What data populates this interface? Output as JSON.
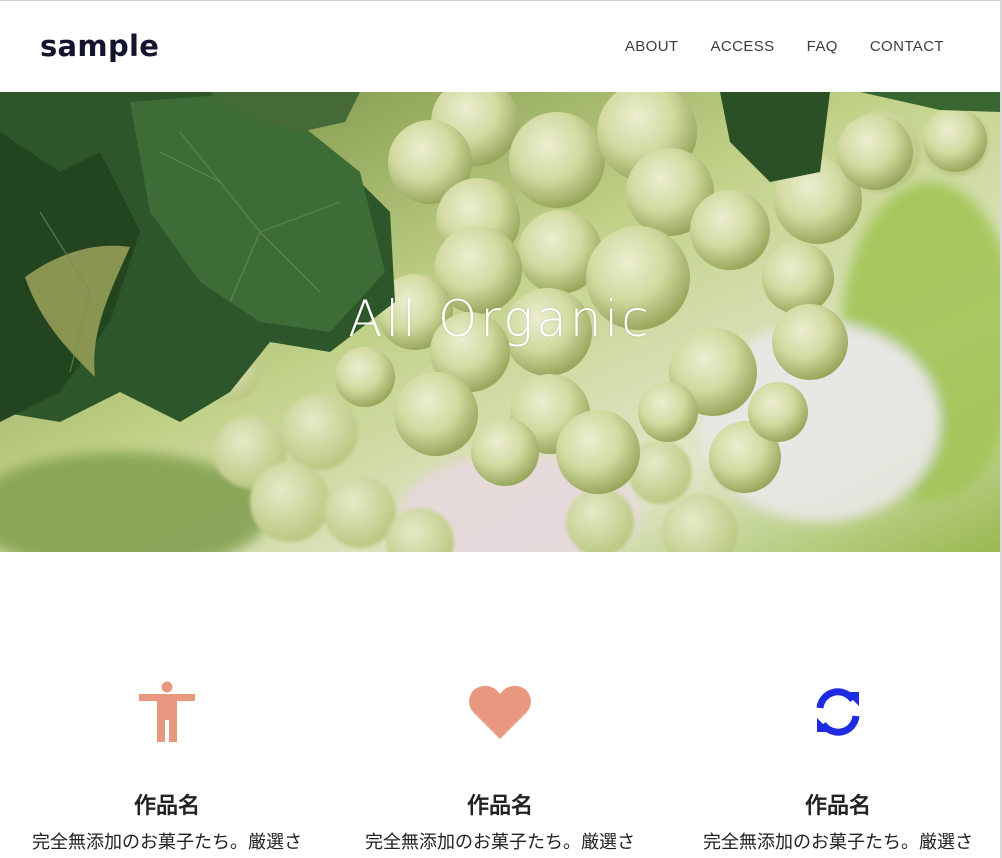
{
  "header": {
    "logo": "sample",
    "nav": [
      "ABOUT",
      "ACCESS",
      "FAQ",
      "CONTACT"
    ]
  },
  "hero": {
    "title": "All Organic"
  },
  "features": [
    {
      "icon": "accessibility-person-icon",
      "icon_color": "#e8987f",
      "title": "作品名",
      "text": "完全無添加のお菓子たち。厳選さ"
    },
    {
      "icon": "heart-icon",
      "icon_color": "#e8987f",
      "title": "作品名",
      "text": "完全無添加のお菓子たち。厳選さ"
    },
    {
      "icon": "refresh-icon",
      "icon_color": "#1f2be0",
      "title": "作品名",
      "text": "完全無添加のお菓子たち。厳選さ"
    }
  ]
}
